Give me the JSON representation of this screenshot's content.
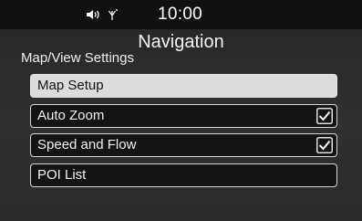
{
  "status": {
    "time": "10:00",
    "icons": [
      "volume-icon",
      "signal-icon"
    ]
  },
  "header": {
    "title": "Navigation",
    "subtitle": "Map/View Settings"
  },
  "menu": {
    "items": [
      {
        "label": "Map Setup",
        "selected": true,
        "checkbox": false
      },
      {
        "label": "Auto Zoom",
        "selected": false,
        "checkbox": true,
        "checked": true
      },
      {
        "label": "Speed and Flow",
        "selected": false,
        "checkbox": true,
        "checked": true
      },
      {
        "label": "POI List",
        "selected": false,
        "checkbox": false
      }
    ]
  }
}
